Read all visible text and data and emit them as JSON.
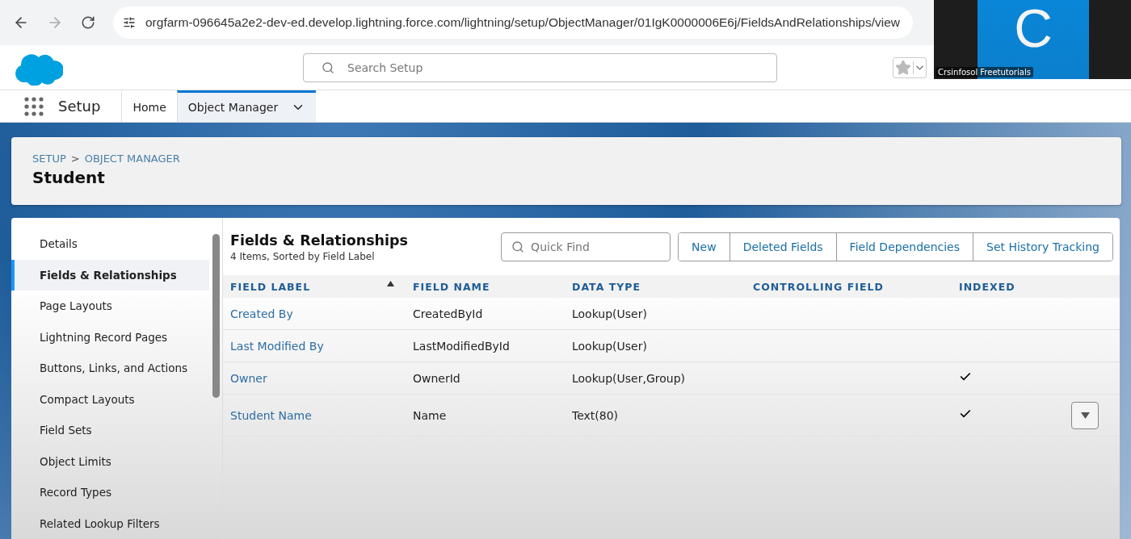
{
  "browser": {
    "url": "orgfarm-096645a2e2-dev-ed.develop.lightning.force.com/lightning/setup/ObjectManager/01IgK0000006E6j/FieldsAndRelationships/view"
  },
  "header": {
    "search": {
      "placeholder": "Search Setup"
    }
  },
  "video_tile": {
    "initial": "C",
    "name": "Crsinfosol Freetutorials"
  },
  "app_nav": {
    "app_name": "Setup",
    "tabs": [
      {
        "label": "Home",
        "selected": false
      },
      {
        "label": "Object Manager",
        "selected": true
      }
    ]
  },
  "page_header": {
    "breadcrumb": [
      "SETUP",
      "OBJECT MANAGER"
    ],
    "separator": ">",
    "title": "Student"
  },
  "sidebar": {
    "items": [
      {
        "label": "Details",
        "selected": false
      },
      {
        "label": "Fields & Relationships",
        "selected": true
      },
      {
        "label": "Page Layouts",
        "selected": false
      },
      {
        "label": "Lightning Record Pages",
        "selected": false
      },
      {
        "label": "Buttons, Links, and Actions",
        "selected": false
      },
      {
        "label": "Compact Layouts",
        "selected": false
      },
      {
        "label": "Field Sets",
        "selected": false
      },
      {
        "label": "Object Limits",
        "selected": false
      },
      {
        "label": "Record Types",
        "selected": false
      },
      {
        "label": "Related Lookup Filters",
        "selected": false
      }
    ]
  },
  "content": {
    "title": "Fields & Relationships",
    "subtitle": "4 Items, Sorted by Field Label",
    "quick_find": {
      "placeholder": "Quick Find"
    },
    "buttons": [
      "New",
      "Deleted Fields",
      "Field Dependencies",
      "Set History Tracking"
    ],
    "table": {
      "columns": [
        {
          "label": "FIELD LABEL",
          "sorted": true
        },
        {
          "label": "FIELD NAME",
          "sorted": false
        },
        {
          "label": "DATA TYPE",
          "sorted": false
        },
        {
          "label": "CONTROLLING FIELD",
          "sorted": false
        },
        {
          "label": "INDEXED",
          "sorted": false
        }
      ],
      "rows": [
        {
          "field_label": "Created By",
          "field_name": "CreatedById",
          "data_type": "Lookup(User)",
          "indexed": false,
          "actions_visible": false
        },
        {
          "field_label": "Last Modified By",
          "field_name": "LastModifiedById",
          "data_type": "Lookup(User)",
          "indexed": false,
          "actions_visible": false
        },
        {
          "field_label": "Owner",
          "field_name": "OwnerId",
          "data_type": "Lookup(User,Group)",
          "indexed": true,
          "actions_visible": false
        },
        {
          "field_label": "Student Name",
          "field_name": "Name",
          "data_type": "Text(80)",
          "indexed": true,
          "actions_visible": true
        }
      ]
    }
  }
}
